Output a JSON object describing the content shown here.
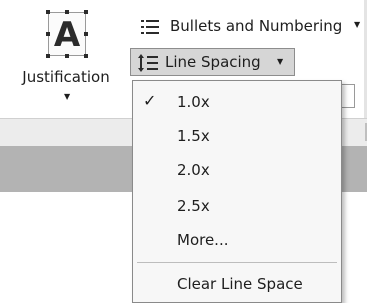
{
  "ribbon": {
    "justification": {
      "label": "Justification",
      "icon": "text-justification-icon",
      "icon_glyph": "A"
    },
    "bullets": {
      "label": "Bullets and Numbering",
      "icon": "bulleted-list-icon"
    },
    "line_spacing": {
      "label": "Line Spacing",
      "icon": "line-spacing-icon"
    }
  },
  "menu": {
    "items": [
      {
        "label": "1.0x",
        "checked": true
      },
      {
        "label": "1.5x",
        "checked": false
      },
      {
        "label": "2.0x",
        "checked": false
      },
      {
        "label": "2.5x",
        "checked": false
      },
      {
        "label": "More...",
        "checked": false
      }
    ],
    "clear_label": "Clear Line Space",
    "check_glyph": "✓"
  },
  "colors": {
    "pressed_button": "#d6d6d6",
    "workspace": "#b3b3b3",
    "menu_background": "#f7f7f7"
  }
}
